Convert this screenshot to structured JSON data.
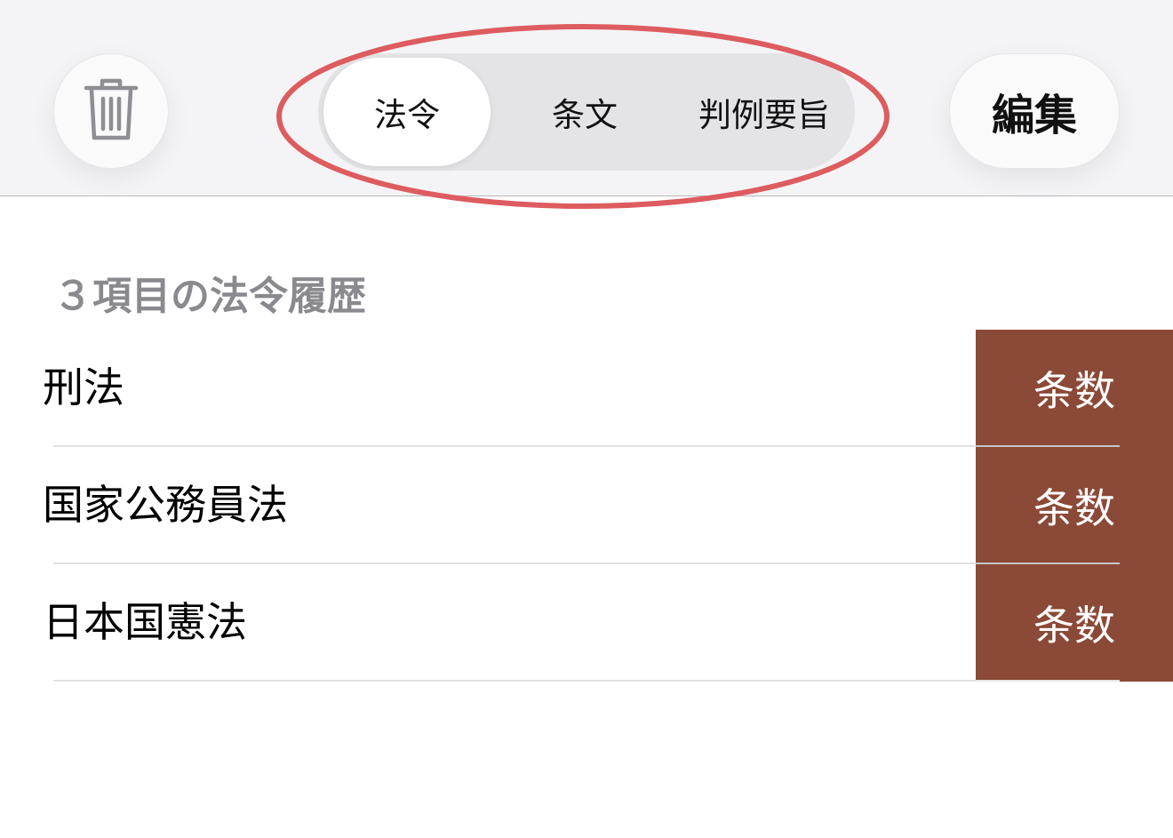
{
  "header": {
    "trash_icon": "trash-icon",
    "segments": [
      {
        "label": "法令",
        "selected": true
      },
      {
        "label": "条文",
        "selected": false
      },
      {
        "label": "判例要旨",
        "selected": false
      }
    ],
    "edit_label": "編集"
  },
  "list": {
    "section_title": "３項目の法令履歴",
    "items": [
      {
        "label": "刑法",
        "action": "条数"
      },
      {
        "label": "国家公務員法",
        "action": "条数"
      },
      {
        "label": "日本国憲法",
        "action": "条数"
      }
    ]
  },
  "colors": {
    "action_background": "#8b4937",
    "highlight_ring": "#dd5c60",
    "header_background": "#f4f4f6",
    "section_title": "#8a8a8e"
  }
}
